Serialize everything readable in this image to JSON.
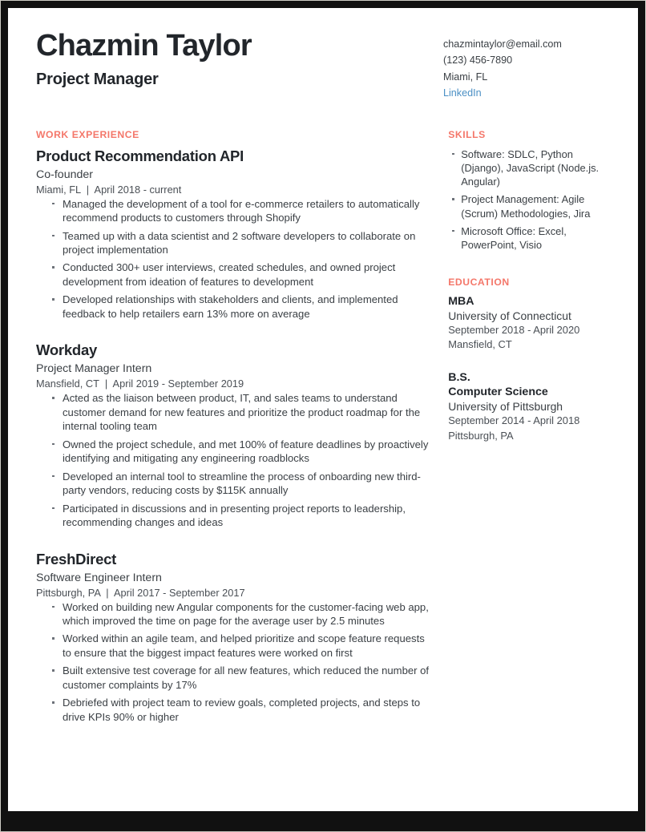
{
  "header": {
    "name": "Chazmin Taylor",
    "title": "Project Manager",
    "contact": {
      "email": "chazmintaylor@email.com",
      "phone": "(123) 456-7890",
      "location": "Miami, FL",
      "link_label": "LinkedIn",
      "link_color": "#4a8fc4"
    }
  },
  "accent_color": "#f4776a",
  "work": {
    "heading": "WORK EXPERIENCE",
    "jobs": [
      {
        "org": "Product Recommendation API",
        "role": "Co-founder",
        "meta": "Miami, FL  |  April 2018 - current",
        "bullets": [
          "Managed the development of a tool for e-commerce retailers to automatically recommend products to customers through Shopify",
          "Teamed up with a data scientist and 2 software developers to collaborate on project implementation",
          "Conducted 300+ user interviews, created schedules, and owned project development from ideation of features to development",
          "Developed relationships with stakeholders and clients, and implemented feedback to help retailers earn 13% more on average"
        ]
      },
      {
        "org": "Workday",
        "role": "Project Manager Intern",
        "meta": "Mansfield, CT  |  April 2019 - September 2019",
        "bullets": [
          "Acted as the liaison between product, IT, and sales teams to understand customer demand for new features and prioritize the product roadmap for the internal tooling team",
          "Owned the project schedule, and met 100% of feature deadlines by proactively identifying and mitigating any engineering roadblocks",
          "Developed an internal tool to streamline the process of onboarding new third-party vendors, reducing costs by $115K annually",
          "Participated in discussions and in presenting project reports to leadership, recommending changes and ideas"
        ]
      },
      {
        "org": "FreshDirect",
        "role": "Software Engineer Intern",
        "meta": "Pittsburgh, PA  |  April 2017 - September 2017",
        "bullets": [
          "Worked on building new Angular components for the customer-facing web app, which improved the time on page for the average user by 2.5 minutes",
          "Worked within an agile team, and helped prioritize and scope feature requests to ensure that the biggest impact features were worked on first",
          "Built extensive test coverage for all new features, which reduced the number of customer complaints by 17%",
          "Debriefed with project team to review goals, completed projects, and steps to drive KPIs 90% or higher"
        ]
      }
    ]
  },
  "skills": {
    "heading": "SKILLS",
    "items": [
      "Software: SDLC, Python (Django), JavaScript (Node.js. Angular)",
      "Project Management: Agile (Scrum) Methodologies, Jira",
      "Microsoft Office: Excel, PowerPoint, Visio"
    ]
  },
  "education": {
    "heading": "EDUCATION",
    "entries": [
      {
        "degree": "MBA",
        "degree2": "",
        "school": "University of Connecticut",
        "dates": "September 2018 - April 2020",
        "location": "Mansfield, CT"
      },
      {
        "degree": "B.S.",
        "degree2": "Computer Science",
        "school": "University of Pittsburgh",
        "dates": "September 2014 - April 2018",
        "location": "Pittsburgh, PA"
      }
    ]
  }
}
